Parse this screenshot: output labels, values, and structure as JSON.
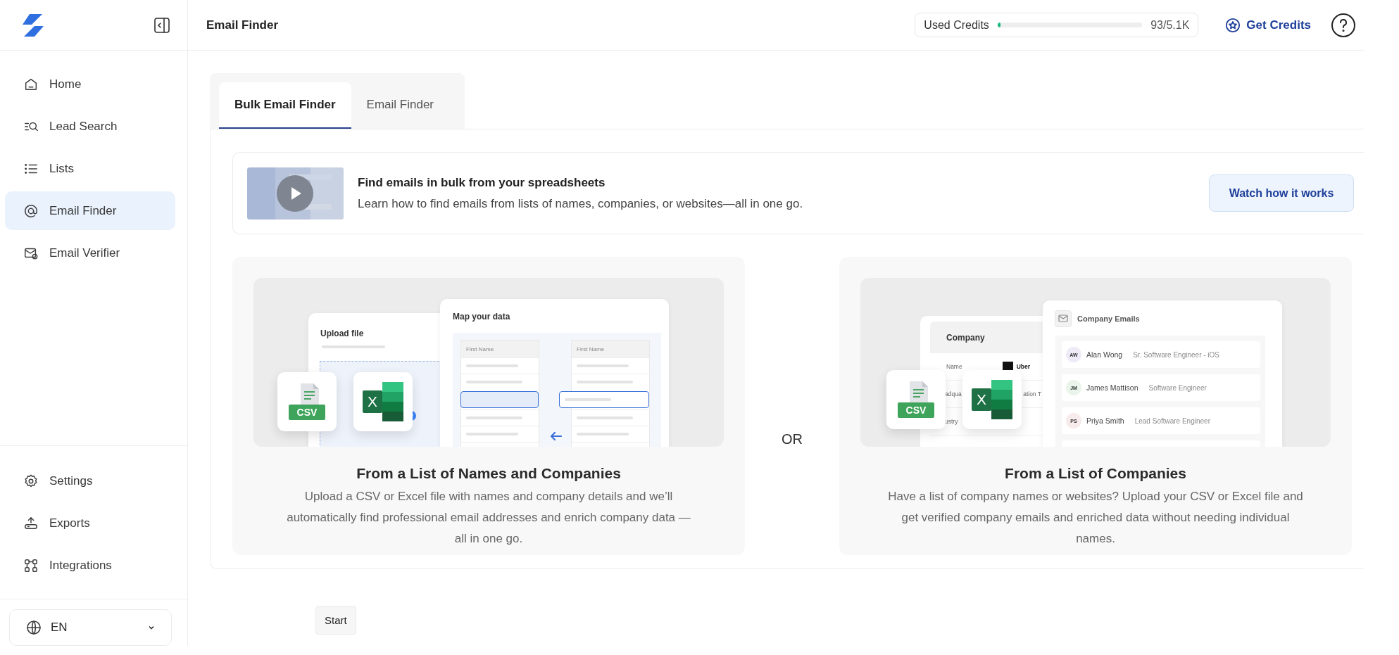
{
  "sidebar": {
    "nav_items": [
      {
        "label": "Home",
        "selected": false
      },
      {
        "label": "Lead Search",
        "selected": false
      },
      {
        "label": "Lists",
        "selected": false
      },
      {
        "label": "Email Finder",
        "selected": true
      },
      {
        "label": "Email Verifier",
        "selected": false
      }
    ],
    "footer_items": [
      {
        "label": "Settings",
        "selected": false
      },
      {
        "label": "Exports",
        "selected": false
      },
      {
        "label": "Integrations",
        "selected": false
      }
    ],
    "language": {
      "value": "EN"
    }
  },
  "header": {
    "title": "Email Finder",
    "credits": {
      "label": "Used Credits",
      "level": 0.018,
      "reading": "93/5.1K"
    },
    "get_credits": "Get Credits"
  },
  "tabs": [
    {
      "label": "Bulk Email Finder",
      "selected": true
    },
    {
      "label": "Email Finder",
      "selected": false
    }
  ],
  "banner": {
    "title": "Find emails in bulk from your spreadsheets",
    "text": "Learn how to find emails from lists of names, companies, or websites—all in one go.",
    "button": "Watch how it works"
  },
  "separator": "OR",
  "cards": [
    {
      "kind": "names",
      "title": "From a List of Names and Companies",
      "text": "Upload a CSV or Excel file with names and company details and we’ll automatically find professional email addresses and enrich company data — all in one go.",
      "illustration": {
        "upload_title": "Upload file",
        "map_title": "Map your data",
        "column_headers": [
          "First Name",
          "First Name"
        ],
        "file_badge": "CSV",
        "excel_mark": "X"
      }
    },
    {
      "kind": "companies",
      "title": "From a List of Companies",
      "text": "Have a list of company names or websites? Upload your CSV or Excel file and get verified company emails and enriched data without needing individual names.",
      "illustration": {
        "company_title": "Company",
        "company_rows": [
          {
            "label": "Name",
            "value": "Uber"
          },
          {
            "label": "adqua",
            "value": "ation T"
          },
          {
            "label": "ustry"
          }
        ],
        "emails_title": "Company Emails",
        "people": [
          {
            "initials": "AW",
            "name": "Alan Wong",
            "role": "Sr. Software Engineer - iOS",
            "color": "#efeaf7"
          },
          {
            "initials": "JM",
            "name": "James Mattison",
            "role": "Software Engineer",
            "color": "#eaf4ea"
          },
          {
            "initials": "PS",
            "name": "Priya Smith",
            "role": "Lead Software Engineer",
            "color": "#f7ebeb"
          }
        ],
        "file_badge": "CSV",
        "excel_mark": "X"
      }
    }
  ],
  "start_button": "Start"
}
